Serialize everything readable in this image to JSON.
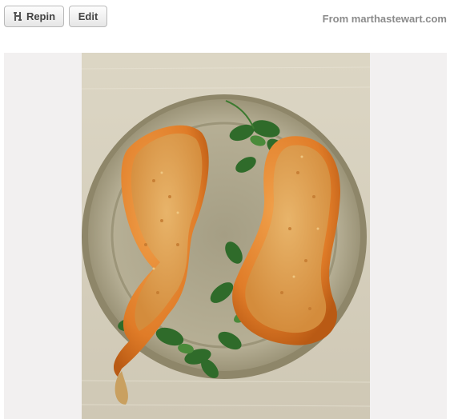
{
  "toolbar": {
    "repin_label": "Repin",
    "edit_label": "Edit",
    "source_prefix": "From",
    "source_domain": "marthastewart.com"
  },
  "pin": {
    "image_alt": "Baked stuffed butternut squash halves with breadcrumb topping on a ceramic plate with greens"
  },
  "colors": {
    "button_text": "#444444",
    "source_text": "#8b8b8b",
    "frame_bg": "#f2f0f0"
  }
}
